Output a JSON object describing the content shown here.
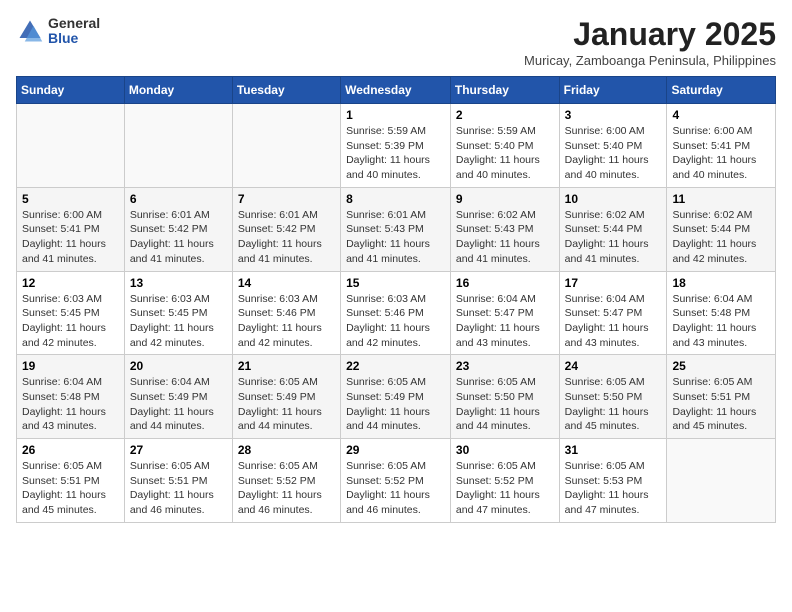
{
  "logo": {
    "general": "General",
    "blue": "Blue"
  },
  "title": "January 2025",
  "subtitle": "Muricay, Zamboanga Peninsula, Philippines",
  "headers": [
    "Sunday",
    "Monday",
    "Tuesday",
    "Wednesday",
    "Thursday",
    "Friday",
    "Saturday"
  ],
  "weeks": [
    [
      {
        "day": "",
        "info": ""
      },
      {
        "day": "",
        "info": ""
      },
      {
        "day": "",
        "info": ""
      },
      {
        "day": "1",
        "info": "Sunrise: 5:59 AM\nSunset: 5:39 PM\nDaylight: 11 hours\nand 40 minutes."
      },
      {
        "day": "2",
        "info": "Sunrise: 5:59 AM\nSunset: 5:40 PM\nDaylight: 11 hours\nand 40 minutes."
      },
      {
        "day": "3",
        "info": "Sunrise: 6:00 AM\nSunset: 5:40 PM\nDaylight: 11 hours\nand 40 minutes."
      },
      {
        "day": "4",
        "info": "Sunrise: 6:00 AM\nSunset: 5:41 PM\nDaylight: 11 hours\nand 40 minutes."
      }
    ],
    [
      {
        "day": "5",
        "info": "Sunrise: 6:00 AM\nSunset: 5:41 PM\nDaylight: 11 hours\nand 41 minutes."
      },
      {
        "day": "6",
        "info": "Sunrise: 6:01 AM\nSunset: 5:42 PM\nDaylight: 11 hours\nand 41 minutes."
      },
      {
        "day": "7",
        "info": "Sunrise: 6:01 AM\nSunset: 5:42 PM\nDaylight: 11 hours\nand 41 minutes."
      },
      {
        "day": "8",
        "info": "Sunrise: 6:01 AM\nSunset: 5:43 PM\nDaylight: 11 hours\nand 41 minutes."
      },
      {
        "day": "9",
        "info": "Sunrise: 6:02 AM\nSunset: 5:43 PM\nDaylight: 11 hours\nand 41 minutes."
      },
      {
        "day": "10",
        "info": "Sunrise: 6:02 AM\nSunset: 5:44 PM\nDaylight: 11 hours\nand 41 minutes."
      },
      {
        "day": "11",
        "info": "Sunrise: 6:02 AM\nSunset: 5:44 PM\nDaylight: 11 hours\nand 42 minutes."
      }
    ],
    [
      {
        "day": "12",
        "info": "Sunrise: 6:03 AM\nSunset: 5:45 PM\nDaylight: 11 hours\nand 42 minutes."
      },
      {
        "day": "13",
        "info": "Sunrise: 6:03 AM\nSunset: 5:45 PM\nDaylight: 11 hours\nand 42 minutes."
      },
      {
        "day": "14",
        "info": "Sunrise: 6:03 AM\nSunset: 5:46 PM\nDaylight: 11 hours\nand 42 minutes."
      },
      {
        "day": "15",
        "info": "Sunrise: 6:03 AM\nSunset: 5:46 PM\nDaylight: 11 hours\nand 42 minutes."
      },
      {
        "day": "16",
        "info": "Sunrise: 6:04 AM\nSunset: 5:47 PM\nDaylight: 11 hours\nand 43 minutes."
      },
      {
        "day": "17",
        "info": "Sunrise: 6:04 AM\nSunset: 5:47 PM\nDaylight: 11 hours\nand 43 minutes."
      },
      {
        "day": "18",
        "info": "Sunrise: 6:04 AM\nSunset: 5:48 PM\nDaylight: 11 hours\nand 43 minutes."
      }
    ],
    [
      {
        "day": "19",
        "info": "Sunrise: 6:04 AM\nSunset: 5:48 PM\nDaylight: 11 hours\nand 43 minutes."
      },
      {
        "day": "20",
        "info": "Sunrise: 6:04 AM\nSunset: 5:49 PM\nDaylight: 11 hours\nand 44 minutes."
      },
      {
        "day": "21",
        "info": "Sunrise: 6:05 AM\nSunset: 5:49 PM\nDaylight: 11 hours\nand 44 minutes."
      },
      {
        "day": "22",
        "info": "Sunrise: 6:05 AM\nSunset: 5:49 PM\nDaylight: 11 hours\nand 44 minutes."
      },
      {
        "day": "23",
        "info": "Sunrise: 6:05 AM\nSunset: 5:50 PM\nDaylight: 11 hours\nand 44 minutes."
      },
      {
        "day": "24",
        "info": "Sunrise: 6:05 AM\nSunset: 5:50 PM\nDaylight: 11 hours\nand 45 minutes."
      },
      {
        "day": "25",
        "info": "Sunrise: 6:05 AM\nSunset: 5:51 PM\nDaylight: 11 hours\nand 45 minutes."
      }
    ],
    [
      {
        "day": "26",
        "info": "Sunrise: 6:05 AM\nSunset: 5:51 PM\nDaylight: 11 hours\nand 45 minutes."
      },
      {
        "day": "27",
        "info": "Sunrise: 6:05 AM\nSunset: 5:51 PM\nDaylight: 11 hours\nand 46 minutes."
      },
      {
        "day": "28",
        "info": "Sunrise: 6:05 AM\nSunset: 5:52 PM\nDaylight: 11 hours\nand 46 minutes."
      },
      {
        "day": "29",
        "info": "Sunrise: 6:05 AM\nSunset: 5:52 PM\nDaylight: 11 hours\nand 46 minutes."
      },
      {
        "day": "30",
        "info": "Sunrise: 6:05 AM\nSunset: 5:52 PM\nDaylight: 11 hours\nand 47 minutes."
      },
      {
        "day": "31",
        "info": "Sunrise: 6:05 AM\nSunset: 5:53 PM\nDaylight: 11 hours\nand 47 minutes."
      },
      {
        "day": "",
        "info": ""
      }
    ]
  ]
}
